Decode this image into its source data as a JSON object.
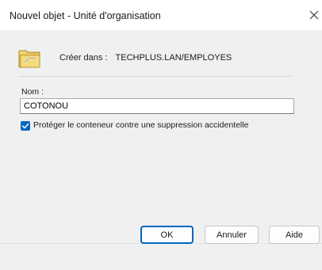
{
  "window": {
    "title": "Nouvel objet - Unité d'organisation",
    "close_glyph": "✕"
  },
  "header": {
    "icon": "folder-ou-icon",
    "create_in_label": "Créer dans :",
    "create_in_path": "TECHPLUS.LAN/EMPLOYES"
  },
  "form": {
    "name_label": "Nom :",
    "name_value": "COTONOU",
    "protect_checkbox_label": "Protéger le conteneur contre une suppression accidentelle",
    "protect_checked": true
  },
  "buttons": {
    "ok_label": "OK",
    "cancel_label": "Annuler",
    "help_label": "Aide"
  },
  "colors": {
    "accent": "#0067c0",
    "background": "#f0f0f0"
  }
}
